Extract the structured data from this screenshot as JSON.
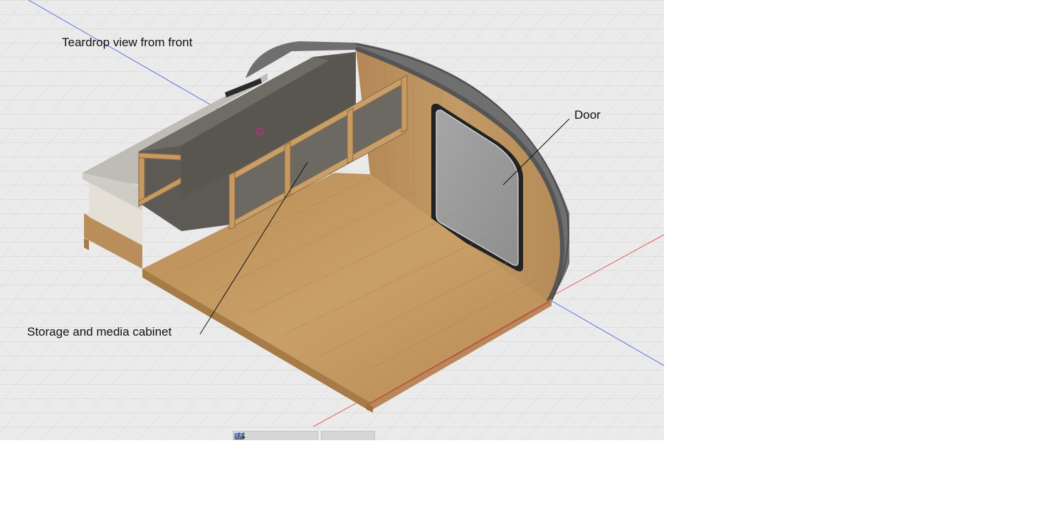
{
  "viewport": {
    "background": "#ebebeb",
    "grid_color": "#d4d4d4",
    "axis_x_color": "#e03030",
    "axis_y_color": "#3050e0"
  },
  "labels": {
    "title": "Teardrop view from front",
    "door": "Door",
    "cabinet": "Storage and media cabinet"
  },
  "toolbar": {
    "groups": [
      [
        "orbit-icon",
        "look-at-icon",
        "pan-icon",
        "zoom-icon",
        "fit-icon"
      ],
      [
        "display-settings-icon",
        "grid-settings-icon",
        "viewports-icon"
      ]
    ]
  },
  "colors": {
    "wood": "#c69a5f",
    "wall_shell": "#6a6a6a",
    "cabinet_dark": "#5f5c57",
    "window_glass": "#9c9c9c"
  }
}
